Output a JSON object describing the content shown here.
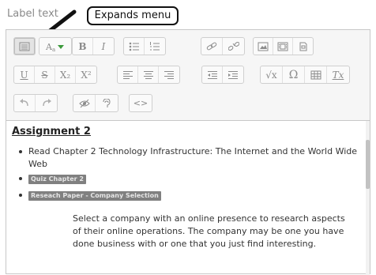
{
  "field_label": "Label text",
  "callout": "Expands menu",
  "toolbar": {
    "rows": [
      [
        {
          "name": "expand-toolbar",
          "icon": "toolbar-toggle-icon",
          "active": true
        },
        {
          "name": "font-color",
          "icon": "font-color-icon"
        },
        {
          "name": "bold",
          "label": "B"
        },
        {
          "name": "italic",
          "label": "I"
        },
        {
          "name": "unordered-list",
          "icon": "bullet-list-icon"
        },
        {
          "name": "ordered-list",
          "icon": "numbered-list-icon"
        },
        {
          "name": "link",
          "icon": "link-icon"
        },
        {
          "name": "unlink",
          "icon": "unlink-icon"
        },
        {
          "name": "insert-image",
          "icon": "image-icon"
        },
        {
          "name": "insert-media",
          "icon": "media-icon"
        },
        {
          "name": "manage-files",
          "icon": "files-icon"
        }
      ],
      [
        {
          "name": "underline",
          "label": "U"
        },
        {
          "name": "strikethrough",
          "label": "S"
        },
        {
          "name": "subscript",
          "label": "X₂"
        },
        {
          "name": "superscript",
          "label": "X²"
        },
        {
          "name": "align-left",
          "icon": "align-left-icon"
        },
        {
          "name": "align-center",
          "icon": "align-center-icon"
        },
        {
          "name": "align-right",
          "icon": "align-right-icon"
        },
        {
          "name": "outdent",
          "icon": "outdent-icon"
        },
        {
          "name": "indent",
          "icon": "indent-icon"
        },
        {
          "name": "equation",
          "label": "√x"
        },
        {
          "name": "special-character",
          "label": "Ω"
        },
        {
          "name": "table",
          "icon": "table-icon"
        },
        {
          "name": "clear-formatting",
          "label": "Tx"
        }
      ],
      [
        {
          "name": "undo",
          "icon": "undo-icon"
        },
        {
          "name": "redo",
          "icon": "redo-icon"
        },
        {
          "name": "accessibility-checker",
          "icon": "accessibility-icon"
        },
        {
          "name": "screenreader-helper",
          "icon": "screenreader-icon"
        },
        {
          "name": "html",
          "label": "<>"
        }
      ]
    ]
  },
  "content": {
    "heading": "Assignment 2",
    "bullets": [
      {
        "text": "Read Chapter 2 Technology Infrastructure: The Internet and the World Wide Web",
        "highlight": false
      },
      {
        "text": "Quiz Chapter 2",
        "highlight": true
      },
      {
        "text": "Reseach Paper - Company Selection",
        "highlight": true
      }
    ],
    "paragraph": "Select a company with an online presence to research aspects of their online operations. The company may be one you have done business with or one that you just find interesting."
  }
}
